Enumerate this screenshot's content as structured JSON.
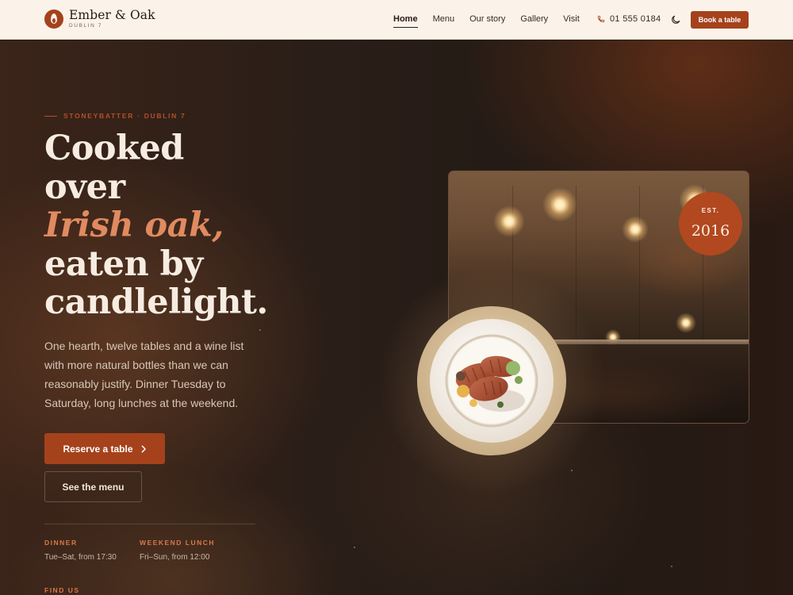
{
  "brand": {
    "name": "Ember & Oak",
    "subtitle": "DUBLIN 7",
    "accent_color": "#a5421c"
  },
  "nav": {
    "items": [
      {
        "label": "Home",
        "active": true
      },
      {
        "label": "Menu",
        "active": false
      },
      {
        "label": "Our story",
        "active": false
      },
      {
        "label": "Gallery",
        "active": false
      },
      {
        "label": "Visit",
        "active": false
      }
    ],
    "phone": "01 555 0184",
    "phone_icon": "phone-icon",
    "theme_icon": "moon-icon",
    "book_label": "Book a table"
  },
  "hero": {
    "eyebrow": "STONEYBATTER · DUBLIN 7",
    "headline": {
      "line1": "Cooked",
      "line2": "over",
      "accent": "Irish oak,",
      "line4": "eaten by",
      "line5": "candlelight."
    },
    "lede": "One hearth, twelve tables and a wine list with more natural bottles than we can reasonably justify. Dinner Tuesday to Saturday, long lunches at the weekend.",
    "primary_cta": "Reserve a table",
    "secondary_cta": "See the menu",
    "info": [
      {
        "label": "DINNER",
        "value": "Tue–Sat, from 17:30"
      },
      {
        "label": "WEEKEND LUNCH",
        "value": "Fri–Sun, from 12:00"
      },
      {
        "label": "FIND US",
        "value": ""
      }
    ]
  },
  "badge": {
    "label": "EST.",
    "year": "2016"
  }
}
